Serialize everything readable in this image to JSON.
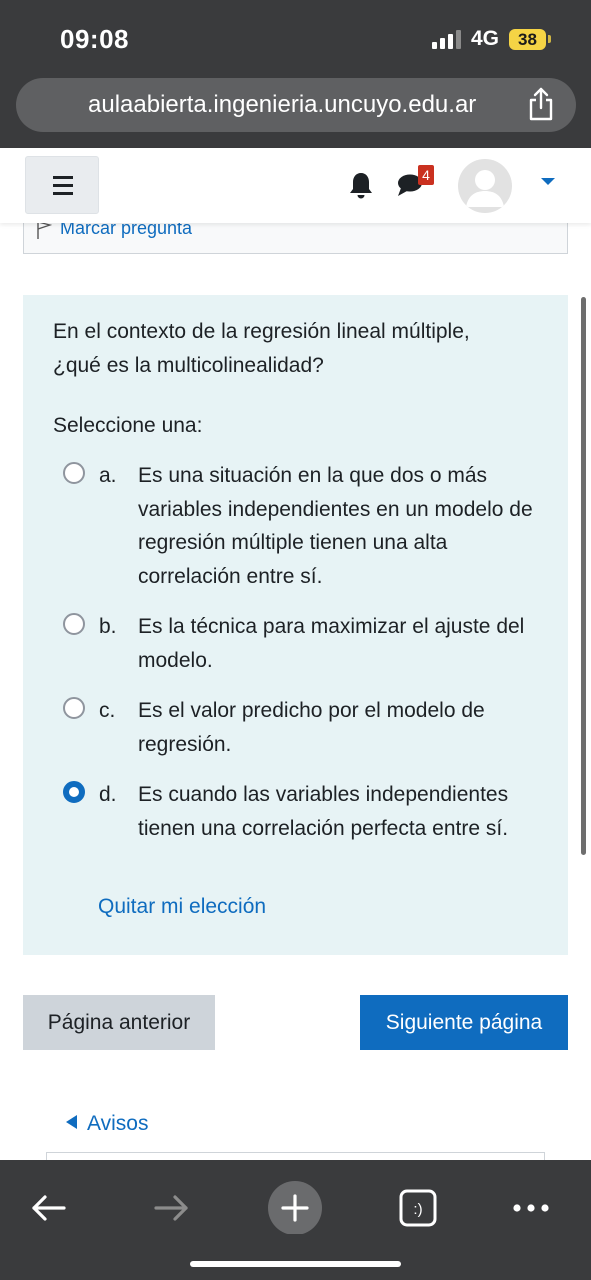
{
  "status_bar": {
    "time": "09:08",
    "network": "4G",
    "battery": "38"
  },
  "browser": {
    "url": "aulaabierta.ingenieria.uncuyo.edu.ar"
  },
  "navbar": {
    "message_count": "4"
  },
  "question_info": {
    "flag_label": "Marcar pregunta"
  },
  "question": {
    "text": "En el contexto de la regresión lineal múltiple, ¿qué es la multicolinealidad?",
    "prompt": "Seleccione una:",
    "options": [
      {
        "letter": "a.",
        "text": "Es una situación en la que dos o más variables independientes en un modelo de regresión múltiple tienen una alta correlación entre sí.",
        "selected": false
      },
      {
        "letter": "b.",
        "text": "Es la técnica para maximizar el ajuste del modelo.",
        "selected": false
      },
      {
        "letter": "c.",
        "text": "Es el valor predicho por el modelo de regresión.",
        "selected": false
      },
      {
        "letter": "d.",
        "text": "Es cuando las variables independientes tienen una correlación perfecta entre sí.",
        "selected": true
      }
    ],
    "clear_label": "Quitar mi elección"
  },
  "navigation": {
    "prev_label": "Página anterior",
    "next_label": "Siguiente página"
  },
  "footer_link": {
    "label": "Avisos"
  },
  "colors": {
    "primary": "#0f6cbf",
    "question_bg": "#e7f3f5",
    "badge": "#ca3120"
  }
}
